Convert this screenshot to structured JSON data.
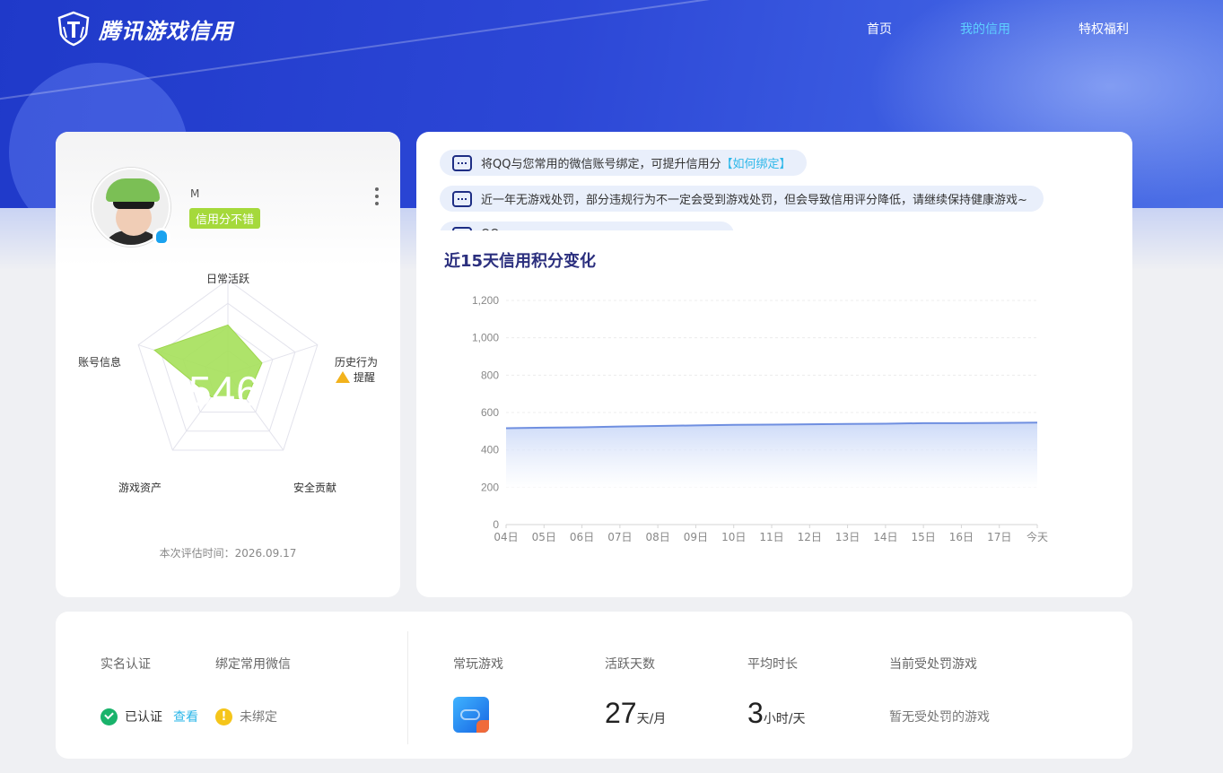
{
  "brand": {
    "name": "腾讯游戏信用"
  },
  "nav": [
    {
      "label": "首页",
      "active": false
    },
    {
      "label": "我的信用",
      "active": true
    },
    {
      "label": "特权福利",
      "active": false
    }
  ],
  "profile": {
    "nickname": "M",
    "credit_tag": "信用分不错",
    "score": "546",
    "radar": {
      "dimensions": [
        "日常活跃",
        "历史行为",
        "安全贡献",
        "游戏资产",
        "账号信息"
      ],
      "values": [
        0.52,
        0.38,
        0.33,
        0.3,
        0.82
      ],
      "warning_label": "提醒"
    },
    "eval_time": "本次评估时间：2026.09.17"
  },
  "notices": [
    {
      "text": "将QQ与您常用的微信账号绑定，可提升信用分",
      "link": "【如何绑定】"
    },
    {
      "text": "近一年无游戏处罚，部分违规行为不一定会受到游戏处罚，但会导致信用评分降低，请继续保持健康游戏~",
      "link": ""
    },
    {
      "text": "QQ",
      "link": ""
    }
  ],
  "chart": {
    "title": "近15天信用积分变化"
  },
  "chart_data": {
    "type": "area",
    "title": "近15天信用积分变化",
    "xlabel": "",
    "ylabel": "",
    "x": [
      "04日",
      "05日",
      "06日",
      "07日",
      "08日",
      "09日",
      "10日",
      "11日",
      "12日",
      "13日",
      "14日",
      "15日",
      "16日",
      "17日",
      "今天"
    ],
    "y_ticks": [
      "0",
      "200",
      "400",
      "600",
      "800",
      "1,000",
      "1,200"
    ],
    "ylim": [
      0,
      1200
    ],
    "series": [
      {
        "values": [
          516,
          519,
          521,
          525,
          528,
          531,
          534,
          535,
          537,
          539,
          540,
          543,
          543,
          544,
          546
        ]
      }
    ],
    "colors": {
      "line": "#6f8fe0",
      "fill_top": "#c7d6f7",
      "fill_bottom": "#ffffff"
    },
    "grid": true
  },
  "stats": {
    "realname": {
      "label": "实名认证",
      "value": "已认证",
      "action": "查看"
    },
    "wechat": {
      "label": "绑定常用微信",
      "value": "未绑定"
    },
    "games": {
      "label": "常玩游戏"
    },
    "active_days": {
      "label": "活跃天数",
      "value": "27",
      "unit": "天/月"
    },
    "avg_time": {
      "label": "平均时长",
      "value": "3",
      "unit": "小时/天"
    },
    "punished": {
      "label": "当前受处罚游戏",
      "value": "暂无受处罚的游戏"
    }
  },
  "colors": {
    "accent": "#2cb7e9",
    "nav_active": "#5ed0ff",
    "radar_fill": "#a5e05a",
    "title": "#2b2f7e"
  }
}
